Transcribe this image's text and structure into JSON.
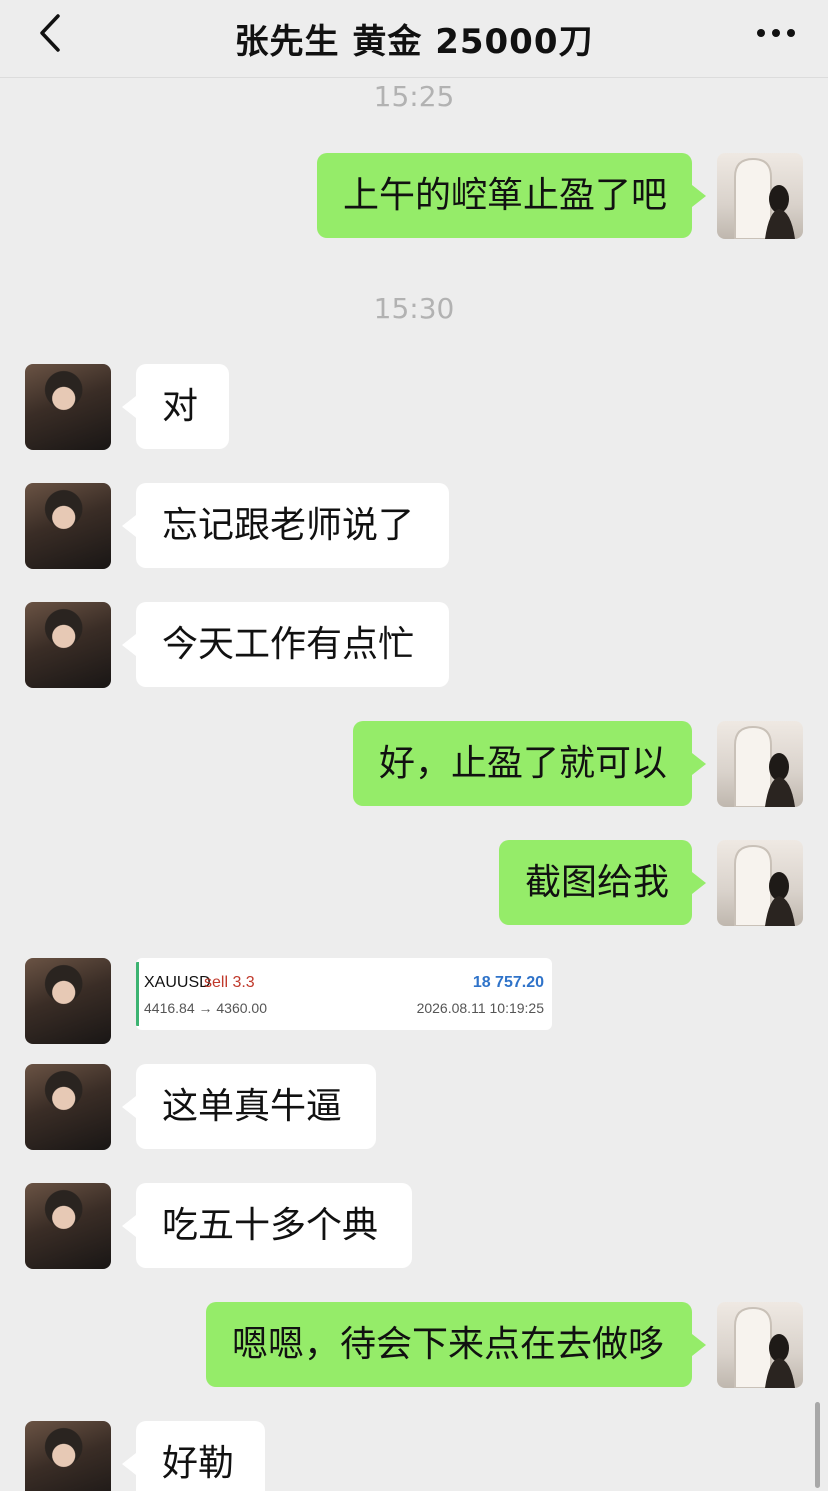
{
  "header": {
    "title": "张先生 黄金 25000刀",
    "back_icon": "chevron-left-icon",
    "more_icon": "more-dots-icon"
  },
  "messages": [
    {
      "type": "time",
      "text": "15:25"
    },
    {
      "type": "sent",
      "text": "上午的崆箪止盈了吧"
    },
    {
      "type": "time",
      "text": "15:30"
    },
    {
      "type": "received",
      "text": "对"
    },
    {
      "type": "received",
      "text": "忘记跟老师说了"
    },
    {
      "type": "received",
      "text": "今天工作有点忙"
    },
    {
      "type": "sent",
      "text": "好，止盈了就可以"
    },
    {
      "type": "sent",
      "text": "截图给我"
    },
    {
      "type": "received",
      "text": "这单真牛逼"
    },
    {
      "type": "received",
      "text": "吃五十多个典"
    },
    {
      "type": "sent",
      "text": "嗯嗯，待会下来点在去做哆"
    },
    {
      "type": "received",
      "text": "好勒"
    }
  ],
  "trade_card": {
    "symbol": "XAUUSD",
    "side": "sell 3.3",
    "profit": "18 757.20",
    "prices": "4416.84 → 4360.00",
    "time": "2026.08.11 10:19:25"
  },
  "colors": {
    "background": "#ededed",
    "sent_bubble": "#95ec69",
    "received_bubble": "#ffffff",
    "sell_red": "#c0392b",
    "profit_blue": "#2f73c9",
    "card_bar_green": "#3cb371"
  }
}
